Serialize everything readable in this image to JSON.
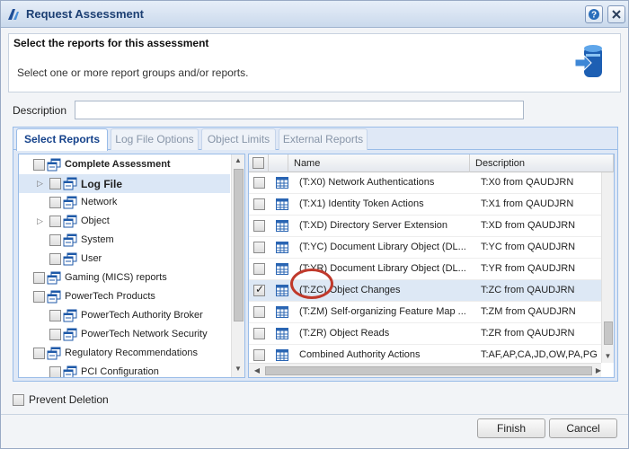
{
  "window": {
    "title": "Request Assessment"
  },
  "header": {
    "title": "Select the reports for this assessment",
    "subtitle": "Select one or more report groups and/or reports."
  },
  "form": {
    "description_label": "Description",
    "description_value": ""
  },
  "tabs": [
    {
      "label": "Select Reports",
      "active": true
    },
    {
      "label": "Log File Options",
      "active": false
    },
    {
      "label": "Object Limits",
      "active": false
    },
    {
      "label": "External Reports",
      "active": false
    }
  ],
  "tree": {
    "items": [
      {
        "label": "Complete Assessment",
        "bold": true,
        "expanded": true,
        "selected": false
      },
      {
        "label": "Log File",
        "bold": true,
        "collapsed": true,
        "selected": true
      },
      {
        "label": "Network",
        "bold": false,
        "selected": false
      },
      {
        "label": "Object",
        "bold": false,
        "collapsed": true,
        "selected": false
      },
      {
        "label": "System",
        "bold": false,
        "selected": false
      },
      {
        "label": "User",
        "bold": false,
        "selected": false
      },
      {
        "label": "Gaming (MICS) reports",
        "bold": false,
        "selected": false
      },
      {
        "label": "PowerTech Products",
        "bold": false,
        "expanded": true,
        "selected": false
      },
      {
        "label": "PowerTech Authority Broker",
        "bold": false,
        "selected": false
      },
      {
        "label": "PowerTech Network Security",
        "bold": false,
        "selected": false
      },
      {
        "label": "Regulatory Recommendations",
        "bold": false,
        "expanded": true,
        "selected": false
      },
      {
        "label": "PCI Configuration",
        "bold": false,
        "selected": false
      }
    ]
  },
  "grid": {
    "columns": [
      "Name",
      "Description"
    ],
    "rows": [
      {
        "name": "(T:X0) Network Authentications",
        "description": "T:X0 from QAUDJRN",
        "checked": false,
        "selected": false
      },
      {
        "name": "(T:X1) Identity Token Actions",
        "description": "T:X1 from QAUDJRN",
        "checked": false,
        "selected": false
      },
      {
        "name": "(T:XD) Directory Server Extension",
        "description": "T:XD from QAUDJRN",
        "checked": false,
        "selected": false
      },
      {
        "name": "(T:YC) Document Library Object (DL...",
        "description": "T:YC from QAUDJRN",
        "checked": false,
        "selected": false
      },
      {
        "name": "(T:YR) Document Library Object (DL...",
        "description": "T:YR from QAUDJRN",
        "checked": false,
        "selected": false
      },
      {
        "name": "(T:ZC) Object Changes",
        "description": "T:ZC from QAUDJRN",
        "checked": true,
        "selected": true
      },
      {
        "name": "(T:ZM) Self-organizing Feature Map ...",
        "description": "T:ZM from QAUDJRN",
        "checked": false,
        "selected": false
      },
      {
        "name": "(T:ZR) Object Reads",
        "description": "T:ZR from QAUDJRN",
        "checked": false,
        "selected": false
      },
      {
        "name": "Combined Authority Actions",
        "description": "T:AF,AP,CA,JD,OW,PA,PG",
        "checked": false,
        "selected": false
      }
    ]
  },
  "options": {
    "prevent_deletion_label": "Prevent Deletion",
    "prevent_deletion_checked": false
  },
  "buttons": {
    "finish": "Finish",
    "cancel": "Cancel"
  },
  "colors": {
    "accent": "#15428b",
    "annotation": "#c0392b",
    "selection": "#dbe7f6"
  }
}
